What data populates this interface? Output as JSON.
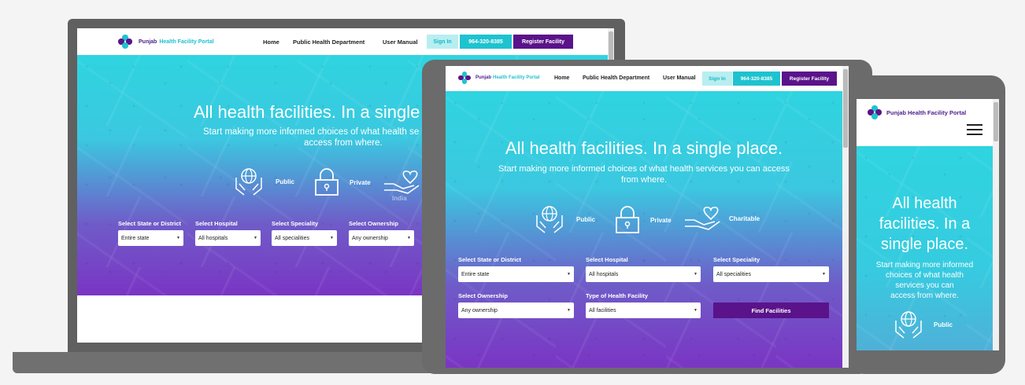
{
  "brand": {
    "name_a": "Punjab",
    "name_b": "Health Facility Portal"
  },
  "nav": {
    "home": "Home",
    "public_health": "Public Health Department",
    "user_manual": "User Manual",
    "sign_in": "Sign In",
    "phone": "964-320-8385",
    "register": "Register Facility"
  },
  "hero": {
    "title": "All health facilities. In a single place.",
    "subtitle": "Start making more informed choices of what health services you can access from where.",
    "laptop_title": "All health facilities. In a single",
    "laptop_sub_1": "Start making more informed choices of what health se",
    "laptop_sub_2": "access from where.",
    "phone_title_1": "All health",
    "phone_title_2": "facilities. In a",
    "phone_title_3": "single place.",
    "phone_sub_1": "Start making more informed",
    "phone_sub_2": "choices of what health",
    "phone_sub_3": "services you can",
    "phone_sub_4": "access from where."
  },
  "categories": {
    "public": "Public",
    "private": "Private",
    "charitable": "Charitable"
  },
  "filters": {
    "state_label": "Select State or District",
    "state_value": "Entire state",
    "hospital_label": "Select Hospital",
    "hospital_value": "All hospitals",
    "speciality_label": "Select Speciality",
    "speciality_value": "All specialities",
    "ownership_label": "Select Ownership",
    "ownership_value": "Any ownership",
    "type_label": "Type of Health Facility",
    "type_value": "All facilities",
    "find": "Find Facilities"
  },
  "map_labels": {
    "india": "India"
  },
  "colors": {
    "teal": "#2fd4e0",
    "purple": "#7a35c4",
    "brand_purple": "#5a138a",
    "brand_teal": "#1ec3cf"
  }
}
